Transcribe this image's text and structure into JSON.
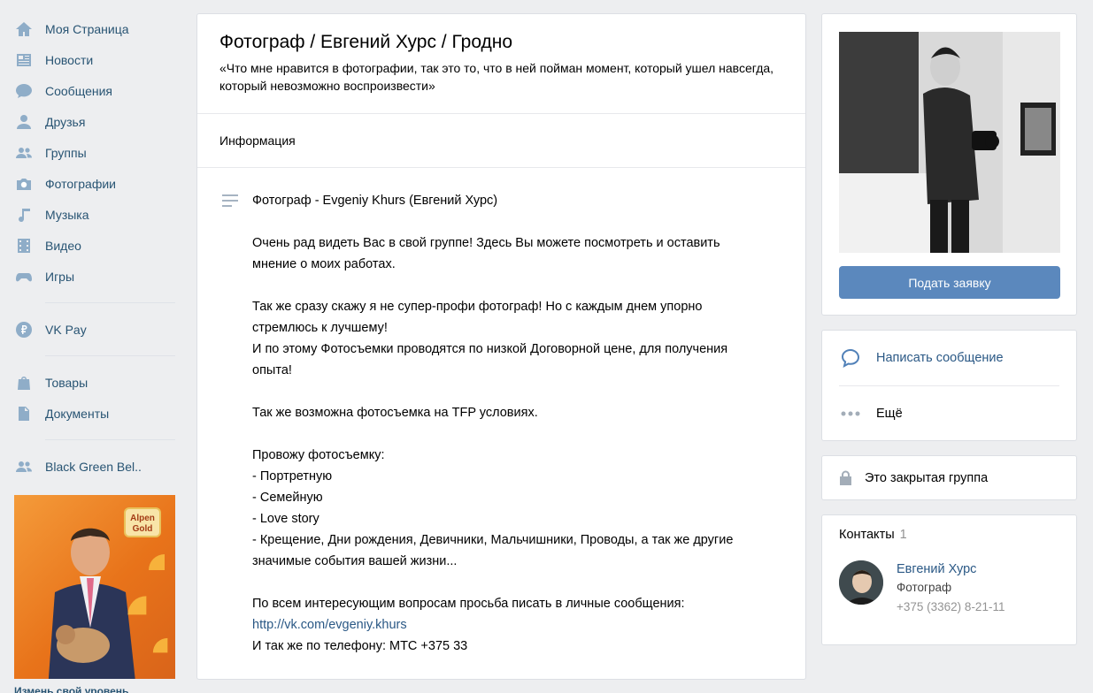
{
  "sidebar": {
    "items": [
      {
        "label": "Моя Страница",
        "icon": "home-icon"
      },
      {
        "label": "Новости",
        "icon": "news-icon"
      },
      {
        "label": "Сообщения",
        "icon": "messages-icon"
      },
      {
        "label": "Друзья",
        "icon": "friends-icon"
      },
      {
        "label": "Группы",
        "icon": "groups-icon"
      },
      {
        "label": "Фотографии",
        "icon": "camera-icon"
      },
      {
        "label": "Музыка",
        "icon": "music-icon"
      },
      {
        "label": "Видео",
        "icon": "video-icon"
      },
      {
        "label": "Игры",
        "icon": "gamepad-icon"
      },
      {
        "label": "VK Pay",
        "icon": "vkpay-icon"
      },
      {
        "label": "Товары",
        "icon": "bag-icon"
      },
      {
        "label": "Документы",
        "icon": "document-icon"
      },
      {
        "label": "Black Green Bel..",
        "icon": "groups-icon"
      }
    ]
  },
  "ad": {
    "brand": "Alpen Gold",
    "caption": "Измень свой уровень"
  },
  "group": {
    "title": "Фотограф / Евгений Хурс / Гродно",
    "status": "«Что мне нравится в фотографии, так это то, что в ней пойман момент, который ушел навсегда, который невозможно воспроизвести»",
    "info_tab": "Информация",
    "description": {
      "title": "Фотограф - Evgeniy Khurs (Евгений Хурс)",
      "p1": "Очень рад видеть Вас в свой группе! Здесь Вы можете посмотреть и оставить мнение о моих работах.",
      "p2_line1": "Так же сразу скажу я не супер-профи фотограф! Но с каждым днем упорно стремлюсь к лучшему!",
      "p2_line2": "И по этому Фотосъемки проводятся по низкой Договорной цене, для получения опыта!",
      "p3": "Так же возможна фотосъемка на TFP условиях.",
      "p4_head": "Провожу фотосъемку:",
      "p4_items": [
        "- Портретную",
        "- Семейную",
        "- Love story",
        "- Крещение, Дни рождения, Девичники, Мальчишники, Проводы, а так же другие значимые события вашей жизни..."
      ],
      "p5_line1": "По всем интересующим вопросам просьба писать в личные сообщения:",
      "p5_link": "http://vk.com/evgeniy.khurs",
      "p5_line2": "И так же по телефону: МТС +375 33"
    }
  },
  "right": {
    "join_label": "Подать заявку",
    "write_label": "Написать сообщение",
    "more_label": "Ещё",
    "closed_label": "Это закрытая группа",
    "contacts_label": "Контакты",
    "contacts_count": "1",
    "contact": {
      "name": "Евгений Хурс",
      "role": "Фотограф",
      "phone": "+375 (3362) 8-21-11"
    }
  },
  "colors": {
    "accent": "#5b88bd",
    "link": "#2a5885",
    "background": "#edeef0"
  }
}
